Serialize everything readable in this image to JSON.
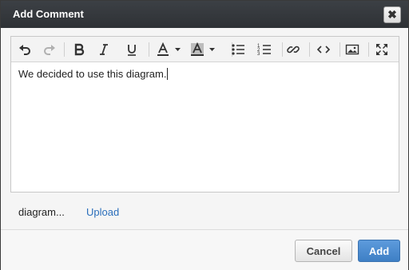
{
  "dialog": {
    "title": "Add Comment",
    "background_ghost_text": "..."
  },
  "toolbar": {
    "buttons": [
      "undo-icon",
      "redo-icon",
      "bold-icon",
      "italic-icon",
      "underline-icon",
      "font-color-icon",
      "highlight-color-icon",
      "bulleted-list-icon",
      "numbered-list-icon",
      "link-icon",
      "code-icon",
      "image-icon",
      "fullscreen-icon"
    ]
  },
  "editor": {
    "text": "We decided to use this diagram."
  },
  "attachment": {
    "name": "diagram...",
    "upload_label": "Upload"
  },
  "footer": {
    "cancel_label": "Cancel",
    "add_label": "Add"
  },
  "colors": {
    "titlebar": "#34383c",
    "link": "#2a6ebb",
    "primary_button": "#4a89cf"
  }
}
